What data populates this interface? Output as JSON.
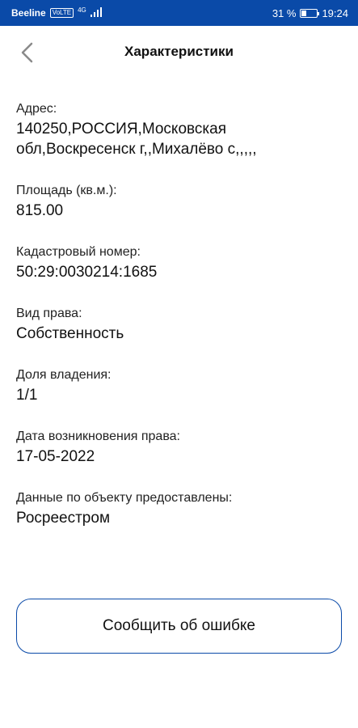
{
  "status_bar": {
    "carrier": "Beeline",
    "volte": "VoLTE",
    "network": "4G",
    "battery": "31 %",
    "battery_level": 0.31,
    "time": "19:24"
  },
  "header": {
    "title": "Характеристики"
  },
  "fields": [
    {
      "label": "Адрес:",
      "value": "140250,РОССИЯ,Московская обл,Воскресенск г,,Михалёво с,,,,,"
    },
    {
      "label": "Площадь (кв.м.):",
      "value": "815.00"
    },
    {
      "label": "Кадастровый номер:",
      "value": "50:29:0030214:1685"
    },
    {
      "label": "Вид права:",
      "value": "Собственность"
    },
    {
      "label": "Доля владения:",
      "value": "1/1"
    },
    {
      "label": "Дата возникновения права:",
      "value": "17-05-2022"
    },
    {
      "label": "Данные по объекту предоставлены:",
      "value": "Росреестром"
    }
  ],
  "report_button": {
    "label": "Сообщить об ошибке"
  },
  "colors": {
    "accent": "#0a4aa8",
    "text": "#111111",
    "back_arrow": "#8a8a8a"
  }
}
